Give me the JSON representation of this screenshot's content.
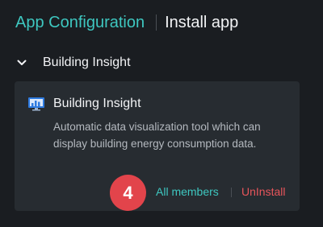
{
  "header": {
    "app_label": "App Configuration",
    "current_label": "Install app"
  },
  "section": {
    "title": "Building Insight",
    "chevron_icon": "chevron-down-icon",
    "expanded": true
  },
  "card": {
    "icon": "bar-chart-monitor-icon",
    "title": "Building Insight",
    "description": "Automatic data visualization tool which can display building energy consumption data."
  },
  "actions": {
    "members_label": "All members",
    "uninstall_label": "UnInstall"
  },
  "step_badge": {
    "number": "4"
  },
  "colors": {
    "accent": "#3ec7c0",
    "danger": "#e8555b",
    "badge": "#e2444b",
    "background": "#1a1d21",
    "card": "#272c31"
  }
}
